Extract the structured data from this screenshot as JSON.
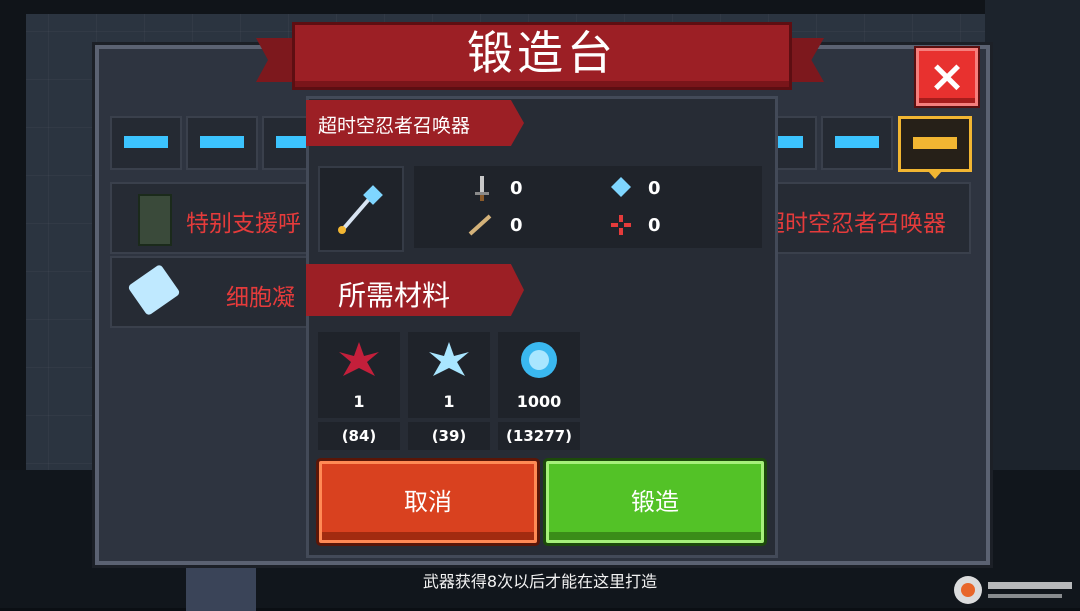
{
  "title": "锻造台",
  "weapon_name": "超时空忍者召唤器",
  "stats": [
    {
      "icon": "sword-damage-icon",
      "value": "0",
      "color": "#c9c9c9"
    },
    {
      "icon": "energy-crystal-icon",
      "value": "0",
      "color": "#7fd6ff"
    },
    {
      "icon": "needle-icon",
      "value": "0",
      "color": "#d4b27a"
    },
    {
      "icon": "crosshair-icon",
      "value": "0",
      "color": "#e53b3b"
    }
  ],
  "materials_header": "所需材料",
  "materials": [
    {
      "icon": "red-crystal-icon",
      "required": "1",
      "owned": "(84)",
      "color": "#c41f3b"
    },
    {
      "icon": "blue-crystal-icon",
      "required": "1",
      "owned": "(39)",
      "color": "#a9e6ff"
    },
    {
      "icon": "gem-coin-icon",
      "required": "1000",
      "owned": "(13277)",
      "color": "#3ab8f0"
    }
  ],
  "buttons": {
    "cancel": "取消",
    "forge": "锻造"
  },
  "background_list": [
    {
      "left_text": "特别支援呼",
      "right_text": "超时空忍者召唤器"
    },
    {
      "left_text": "细胞凝"
    }
  ],
  "hint": "武器获得8次以后才能在这里打造",
  "close_label": "×",
  "colors": {
    "banner": "#9c1f25",
    "cancel": "#d9411f",
    "forge": "#53c227",
    "accent": "#f2b632"
  }
}
